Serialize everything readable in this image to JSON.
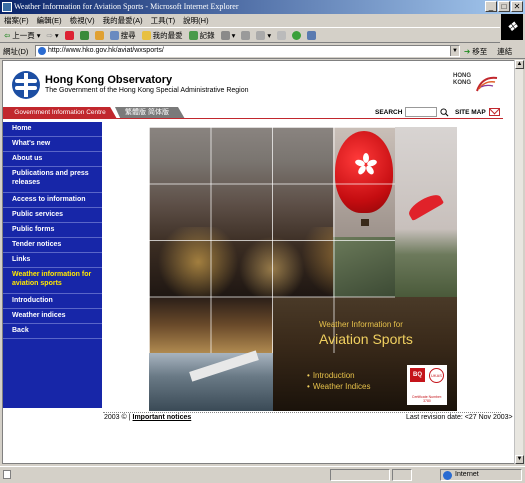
{
  "window": {
    "title": "Weather Information for Aviation Sports - Microsoft Internet Explorer"
  },
  "menu": [
    "檔案(F)",
    "編輯(E)",
    "檢視(V)",
    "我的最愛(A)",
    "工具(T)",
    "說明(H)"
  ],
  "toolbar": {
    "back": "上一頁",
    "search": "搜尋",
    "favorites": "我的最愛",
    "history": "記錄"
  },
  "address": {
    "label": "網址(D)",
    "url": "http://www.hko.gov.hk/aviat/wxsports/",
    "go": "移至",
    "links": "連結"
  },
  "site": {
    "name": "Hong Kong Observatory",
    "subtitle": "The Government of the Hong Kong Special Administrative Region",
    "brand": "HONG KONG"
  },
  "nav": {
    "gov": "Government Information Centre",
    "lang": "繁體版 简体版",
    "search": "SEARCH",
    "sitemap": "SITE MAP"
  },
  "sidebar": [
    {
      "label": "Home"
    },
    {
      "label": "What's new"
    },
    {
      "label": "About us"
    },
    {
      "label": "Publications and press releases"
    },
    {
      "label": "Access to information"
    },
    {
      "label": "Public services"
    },
    {
      "label": "Public forms"
    },
    {
      "label": "Tender notices"
    },
    {
      "label": "Links"
    },
    {
      "label": "Weather information for aviation sports"
    },
    {
      "label": "Introduction"
    },
    {
      "label": "Weather indices"
    },
    {
      "label": "Back"
    }
  ],
  "hero": {
    "line1": "Weather Information for",
    "line2": "Aviation Sports",
    "link1": "Introduction",
    "link2": "Weather Indices",
    "bullet": "•",
    "badge": {
      "bq": "BQ",
      "ukas": "UKAS",
      "cert": "Certificate Number: 3780"
    }
  },
  "footer": {
    "year": "2003 ©",
    "sep": "|",
    "notices": "Important notices",
    "revision": "Last revision date: <27 Nov 2003>"
  },
  "status": {
    "zone": "Internet"
  },
  "colors": {
    "nav_red": "#c1272d",
    "sidebar_blue": "#1726a8",
    "active_yellow": "#ffe800"
  }
}
